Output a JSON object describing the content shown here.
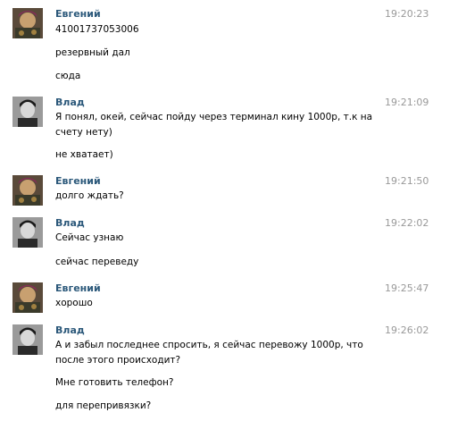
{
  "messages": [
    {
      "sender": "Евгений",
      "time": "19:20:23",
      "avatar": "evgeny",
      "lines": [
        "41001737053006",
        "резервный дал",
        "сюда"
      ]
    },
    {
      "sender": "Влад",
      "time": "19:21:09",
      "avatar": "vlad",
      "lines": [
        "Я понял, окей, сейчас пойду через терминал кину 1000р, т.к на счету нету)",
        "не хватает)"
      ]
    },
    {
      "sender": "Евгений",
      "time": "19:21:50",
      "avatar": "evgeny",
      "lines": [
        "долго ждать?"
      ]
    },
    {
      "sender": "Влад",
      "time": "19:22:02",
      "avatar": "vlad",
      "lines": [
        "Сейчас узнаю",
        "сейчас переведу"
      ]
    },
    {
      "sender": "Евгений",
      "time": "19:25:47",
      "avatar": "evgeny",
      "lines": [
        "хорошо"
      ]
    },
    {
      "sender": "Влад",
      "time": "19:26:02",
      "avatar": "vlad",
      "lines": [
        "А и забыл последнее спросить, я сейчас перевожу 1000р, что после этого происходит?",
        "Мне готовить телефон?",
        "для перепривязки?"
      ]
    }
  ],
  "colors": {
    "sender": "#2b587a",
    "time": "#999999"
  }
}
